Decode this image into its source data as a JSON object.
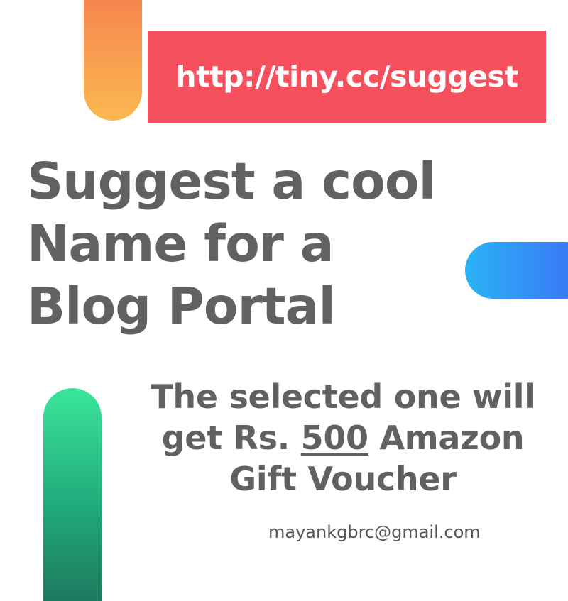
{
  "banner": {
    "url": "http://tiny.cc/suggest"
  },
  "headline": {
    "line1": "Suggest a cool",
    "line2": "Name for a",
    "line3": "Blog Portal"
  },
  "prize": {
    "line1": "The selected one will",
    "line2_prefix": "get Rs. ",
    "amount": "500",
    "line2_suffix": " Amazon",
    "line3": "Gift Voucher"
  },
  "contact": {
    "email": "mayankgbrc@gmail.com"
  },
  "colors": {
    "banner_bg": "#f5505d",
    "text": "#616161",
    "orange_pill": "#f57a4e",
    "blue_pill": "#2ab3f7",
    "green_pill": "#3ae59a"
  }
}
